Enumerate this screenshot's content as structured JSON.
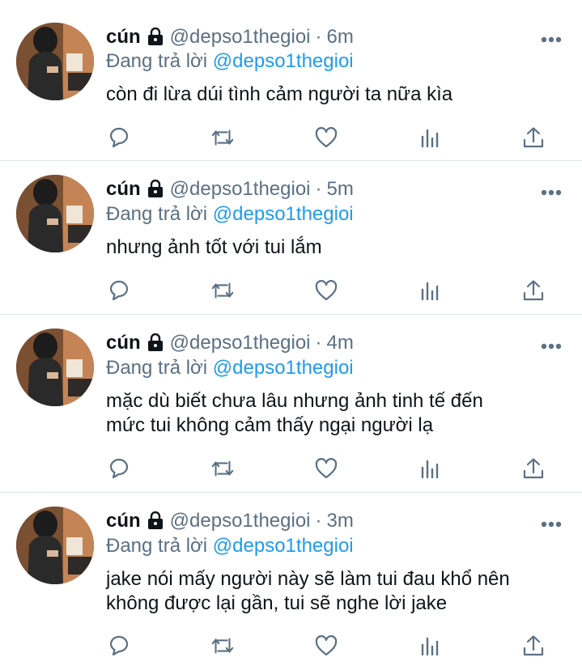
{
  "tweets": [
    {
      "name": "cún",
      "handle": "@depso1thegioi",
      "separator": "·",
      "time": "6m",
      "reply_prefix": "Đang trả lời",
      "reply_to": "@depso1thegioi",
      "text": "còn đi lừa dúi tình cảm người ta nữa kìa"
    },
    {
      "name": "cún",
      "handle": "@depso1thegioi",
      "separator": "·",
      "time": "5m",
      "reply_prefix": "Đang trả lời",
      "reply_to": "@depso1thegioi",
      "text": "nhưng ảnh tốt với tui lắm"
    },
    {
      "name": "cún",
      "handle": "@depso1thegioi",
      "separator": "·",
      "time": "4m",
      "reply_prefix": "Đang trả lời",
      "reply_to": "@depso1thegioi",
      "text": "mặc dù biết chưa lâu nhưng ảnh tinh tế đến mức tui không cảm thấy ngại người lạ"
    },
    {
      "name": "cún",
      "handle": "@depso1thegioi",
      "separator": "·",
      "time": "3m",
      "reply_prefix": "Đang trả lời",
      "reply_to": "@depso1thegioi",
      "text": "jake nói mấy người này sẽ làm tui đau khổ nên không được lại gần, tui sẽ nghe lời jake"
    }
  ],
  "icons": {
    "protected": "lock-icon",
    "more": "more-icon",
    "reply": "reply-icon",
    "retweet": "retweet-icon",
    "like": "like-icon",
    "analytics": "analytics-icon",
    "share": "share-icon"
  },
  "colors": {
    "text": "#0f1419",
    "secondary": "#5b7083",
    "link": "#1d9bf0",
    "divider": "#e1e5e8"
  }
}
